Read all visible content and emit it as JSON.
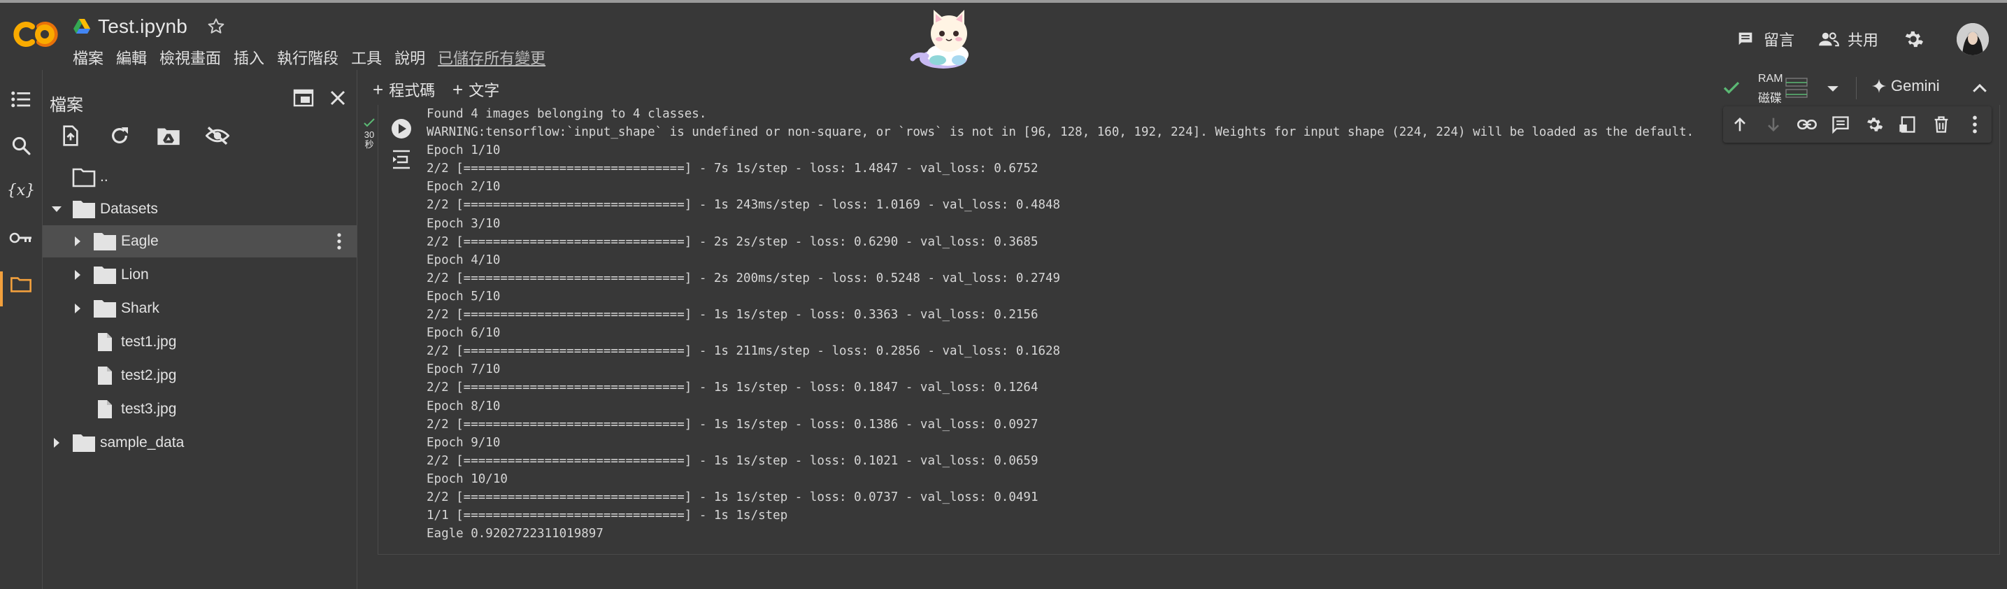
{
  "header": {
    "notebook_title": "Test.ipynb",
    "menu": [
      "檔案",
      "編輯",
      "檢視畫面",
      "插入",
      "執行階段",
      "工具",
      "說明"
    ],
    "saved_status": "已儲存所有變更",
    "comment_label": "留言",
    "share_label": "共用",
    "logo_color": "#f9ab00"
  },
  "rail": {
    "icons": [
      "table-of-contents-icon",
      "search-icon",
      "variables-icon",
      "secrets-key-icon",
      "files-folder-icon"
    ],
    "active_color": "#f2a03d"
  },
  "file_panel": {
    "title": "檔案",
    "tree": [
      {
        "label": "..",
        "type": "folder-up"
      },
      {
        "label": "Datasets",
        "type": "folder",
        "expanded": true
      },
      {
        "label": "Eagle",
        "type": "folder",
        "selected": true
      },
      {
        "label": "Lion",
        "type": "folder"
      },
      {
        "label": "Shark",
        "type": "folder"
      },
      {
        "label": "test1.jpg",
        "type": "file"
      },
      {
        "label": "test2.jpg",
        "type": "file"
      },
      {
        "label": "test3.jpg",
        "type": "file"
      },
      {
        "label": "sample_data",
        "type": "folder"
      }
    ]
  },
  "notebook_toolbar": {
    "add_code": "程式碼",
    "add_text": "文字",
    "ram_label": "RAM",
    "disk_label": "磁碟",
    "gemini_label": "Gemini",
    "status_color": "#5bb974"
  },
  "cell": {
    "exec_time": "30",
    "exec_unit": "秒",
    "output_lines": [
      "Found 4 images belonging to 4 classes.",
      "WARNING:tensorflow:`input_shape` is undefined or non-square, or `rows` is not in [96, 128, 160, 192, 224]. Weights for input shape (224, 224) will be loaded as the default.",
      "Epoch 1/10",
      "2/2 [==============================] - 7s 1s/step - loss: 1.4847 - val_loss: 0.6752",
      "Epoch 2/10",
      "2/2 [==============================] - 1s 243ms/step - loss: 1.0169 - val_loss: 0.4848",
      "Epoch 3/10",
      "2/2 [==============================] - 2s 2s/step - loss: 0.6290 - val_loss: 0.3685",
      "Epoch 4/10",
      "2/2 [==============================] - 2s 200ms/step - loss: 0.5248 - val_loss: 0.2749",
      "Epoch 5/10",
      "2/2 [==============================] - 1s 1s/step - loss: 0.3363 - val_loss: 0.2156",
      "Epoch 6/10",
      "2/2 [==============================] - 1s 211ms/step - loss: 0.2856 - val_loss: 0.1628",
      "Epoch 7/10",
      "2/2 [==============================] - 1s 1s/step - loss: 0.1847 - val_loss: 0.1264",
      "Epoch 8/10",
      "2/2 [==============================] - 1s 1s/step - loss: 0.1386 - val_loss: 0.0927",
      "Epoch 9/10",
      "2/2 [==============================] - 1s 1s/step - loss: 0.1021 - val_loss: 0.0659",
      "Epoch 10/10",
      "2/2 [==============================] - 1s 1s/step - loss: 0.0737 - val_loss: 0.0491",
      "1/1 [==============================] - 1s 1s/step",
      "Eagle 0.9202722311019897"
    ]
  }
}
